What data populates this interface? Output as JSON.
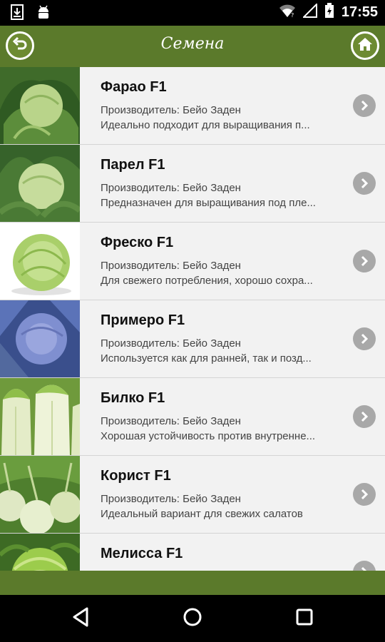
{
  "status_bar": {
    "time": "17:55",
    "icons": [
      "download-icon",
      "android-icon",
      "wifi-icon",
      "signal-icon",
      "battery-icon"
    ]
  },
  "header": {
    "title": "Семена",
    "back_icon": "back-arrow-icon",
    "home_icon": "home-icon",
    "background": "#5b7a2b"
  },
  "items": [
    {
      "title": "Фарао F1",
      "producer": "Производитель: Бейо Заден",
      "description": "Идеально подходит для выращивания п...",
      "image": "green-cabbage"
    },
    {
      "title": "Парел F1",
      "producer": "Производитель: Бейо Заден",
      "description": "Предназначен для выращивания под пле...",
      "image": "green-cabbage"
    },
    {
      "title": "Фреско F1",
      "producer": "Производитель: Бейо Заден",
      "description": "Для свежего потребления, хорошо сохра...",
      "image": "light-cabbage"
    },
    {
      "title": "Примеро F1",
      "producer": "Производитель: Бейо Заден",
      "description": "Используется как для ранней, так и позд...",
      "image": "red-cabbage"
    },
    {
      "title": "Билко F1",
      "producer": "Производитель: Бейо Заден",
      "description": "Хорошая устойчивость против внутренне...",
      "image": "chinese-cabbage"
    },
    {
      "title": "Корист F1",
      "producer": "Производитель: Бейо Заден",
      "description": "Идеальный вариант для свежих салатов",
      "image": "kohlrabi"
    },
    {
      "title": "Мелисса F1",
      "producer": "",
      "description": "",
      "image": "savoy-cabbage"
    }
  ],
  "nav": {
    "back": "nav-back-icon",
    "home": "nav-home-icon",
    "recents": "nav-recents-icon"
  }
}
